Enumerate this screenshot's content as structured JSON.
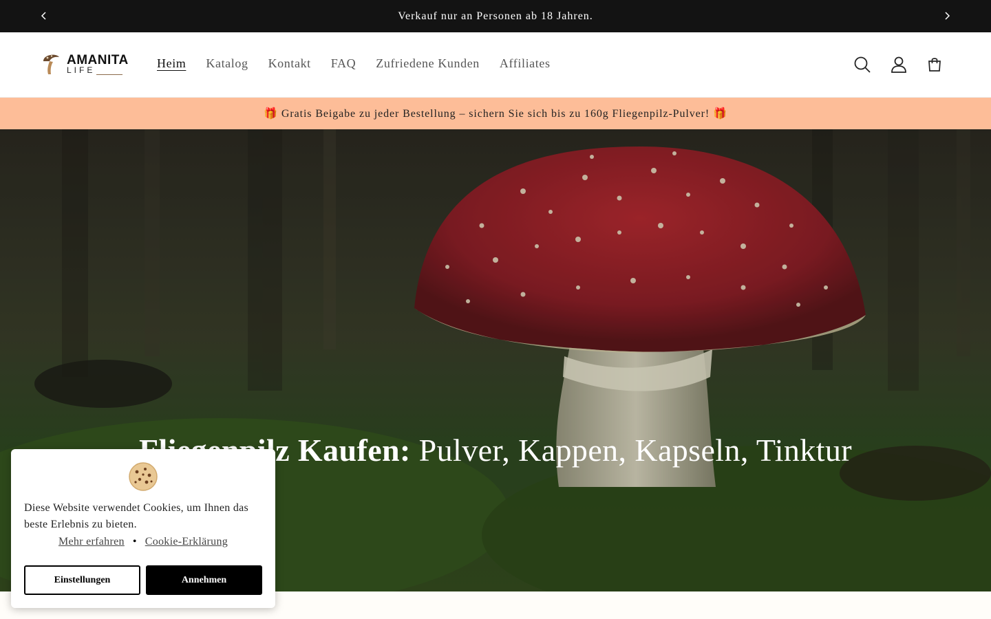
{
  "announcement": {
    "text": "Verkauf nur an Personen ab 18 Jahren.",
    "prev_icon": "chevron-left-icon",
    "next_icon": "chevron-right-icon"
  },
  "header": {
    "logo": {
      "line1": "AMANITA",
      "line2": "LIFE"
    },
    "nav": [
      {
        "label": "Heim",
        "active": true
      },
      {
        "label": "Katalog"
      },
      {
        "label": "Kontakt"
      },
      {
        "label": "FAQ"
      },
      {
        "label": "Zufriedene Kunden"
      },
      {
        "label": "Affiliates"
      }
    ],
    "icons": [
      "search-icon",
      "account-icon",
      "cart-icon"
    ]
  },
  "promo": {
    "text": "🎁 Gratis Beigabe zu jeder Bestellung – sichern Sie sich bis zu 160g Fliegenpilz-Pulver! 🎁"
  },
  "hero": {
    "title_bold": "Fliegenpilz Kaufen:",
    "title_rest": " Pulver, Kappen, Kapseln, Tinktur"
  },
  "cookie_banner": {
    "message": "Diese Website verwendet Cookies, um Ihnen das beste Erlebnis zu bieten.",
    "learn_more": "Mehr erfahren",
    "separator": "•",
    "policy": "Cookie-Erklärung",
    "settings_button": "Einstellungen",
    "accept_button": "Annehmen"
  },
  "colors": {
    "announcement_bg": "#131313",
    "promo_bg": "#fdbd98",
    "mushroom_cap": "#a3272d"
  }
}
